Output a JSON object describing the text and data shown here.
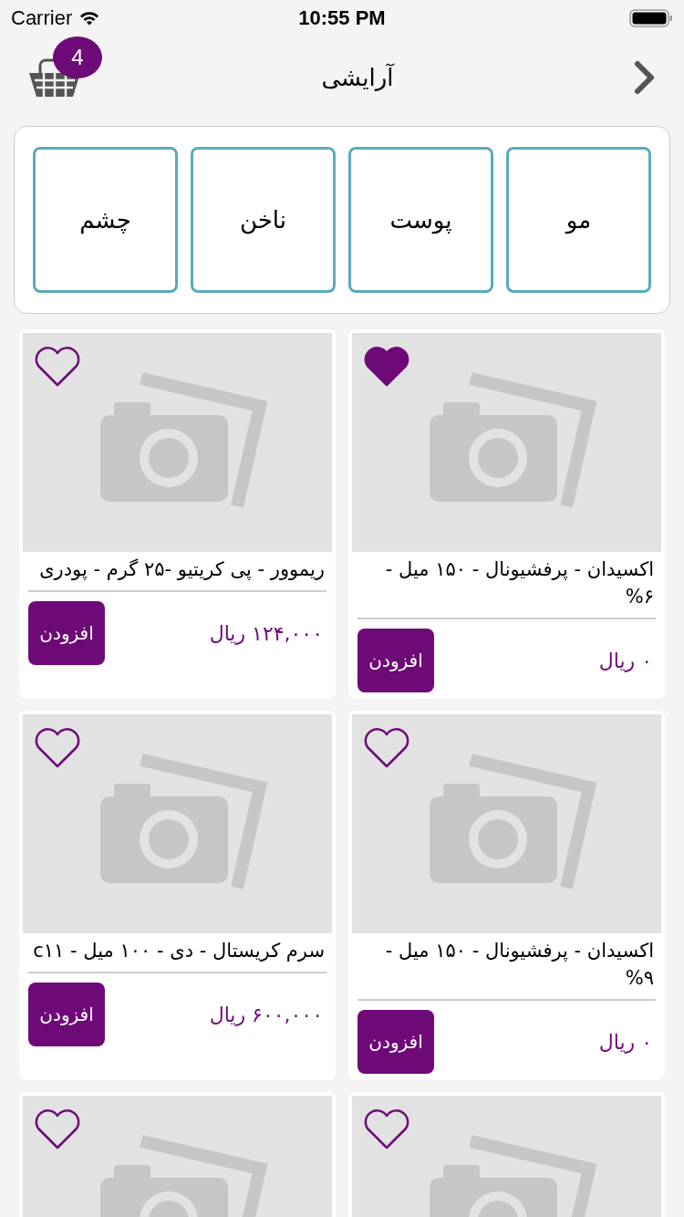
{
  "status_bar": {
    "carrier": "Carrier",
    "time": "10:55 PM"
  },
  "nav": {
    "title": "آرایشی",
    "cart_count": "4"
  },
  "categories": [
    {
      "label": "مو"
    },
    {
      "label": "پوست"
    },
    {
      "label": "ناخن"
    },
    {
      "label": "چشم"
    }
  ],
  "products": [
    {
      "name": "اکسیدان - پرفشیونال - ۱۵۰ میل - ۶%",
      "price": "۰ ریال",
      "button": "افزودن",
      "favorite": true
    },
    {
      "name": "ریموور - پی کریتیو -۲۵ گرم - پودری",
      "price": "۱۲۴,۰۰۰ ریال",
      "button": "افزودن",
      "favorite": false
    },
    {
      "name": "اکسیدان - پرفشیونال - ۱۵۰ میل - ۹%",
      "price": "۰ ریال",
      "button": "افزودن",
      "favorite": false
    },
    {
      "name": "سرم کریستال - دی - ۱۰۰ میل - c۱۱",
      "price": "۶۰۰,۰۰۰ ریال",
      "button": "افزودن",
      "favorite": false
    },
    {
      "favorite": false
    },
    {
      "favorite": false
    }
  ]
}
